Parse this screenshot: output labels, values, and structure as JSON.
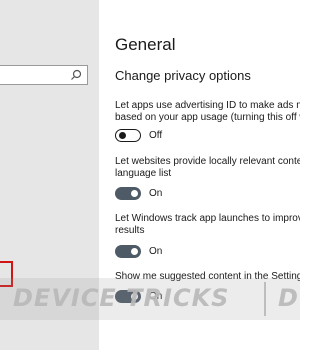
{
  "sidebar": {
    "search": {
      "placeholder": "",
      "icon": "search-icon"
    }
  },
  "content": {
    "page_title": "General",
    "section_title": "Change privacy options",
    "settings": [
      {
        "line1": "Let apps use advertising ID to make ads mo",
        "line2": "based on your app usage (turning this off w",
        "state": "Off",
        "on": false
      },
      {
        "line1": "Let websites provide locally relevant content",
        "line2": "language list",
        "state": "On",
        "on": true
      },
      {
        "line1": "Let Windows track app launches to improve",
        "line2": "results",
        "state": "On",
        "on": true
      },
      {
        "line1": "Show me suggested content in the Settings",
        "line2": "",
        "state": "On",
        "on": true
      }
    ]
  },
  "watermark": {
    "text": "DEVICE TRICKS",
    "text2": "D"
  },
  "colors": {
    "sidebar_bg": "#e6e6e6",
    "toggle_on": "#4e5a66",
    "highlight_box": "#d11414"
  }
}
